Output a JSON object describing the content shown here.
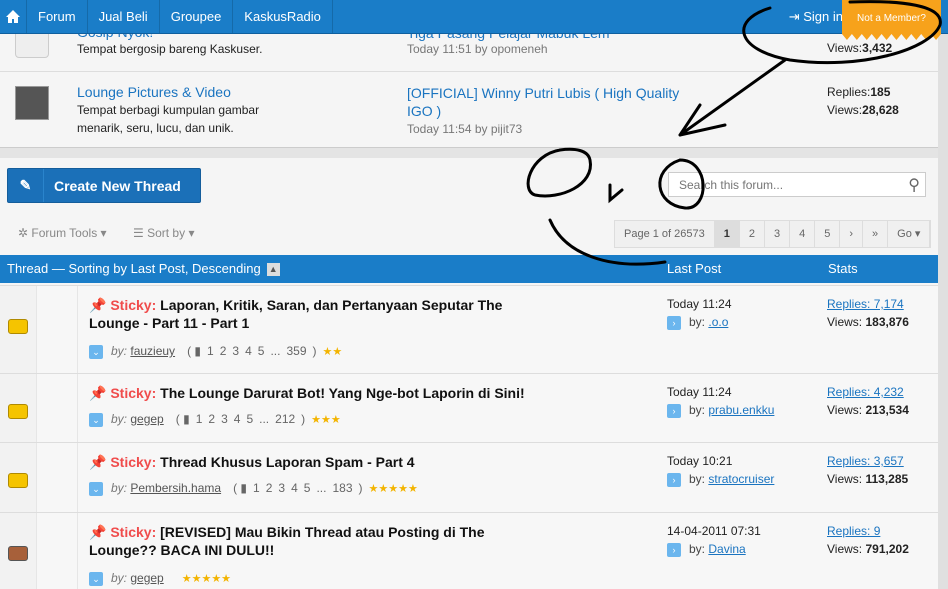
{
  "nav": {
    "home_icon": "home-icon",
    "items": [
      "Forum",
      "Jual Beli",
      "Groupee",
      "KaskusRadio"
    ],
    "sign_in": "Sign in",
    "not_member": "Not a Member?"
  },
  "subforums": [
    {
      "name": "Gosip Nyok!",
      "desc": "Tempat bergosip bareng Kaskuser.",
      "last_post": "Tiga Pasang Pelajar Mabuk Lem",
      "last_meta": "Today 11:51 by opomeneh",
      "replies_label": "Replies:",
      "replies": "",
      "views_label": "Views:",
      "views": "3,432"
    },
    {
      "name": "Lounge Pictures & Video",
      "desc": "Tempat berbagi kumpulan gambar menarik, seru, lucu, dan unik.",
      "last_post": "[OFFICIAL] Winny Putri Lubis ( High Quality IGO )",
      "last_meta": "Today 11:54 by pijit73",
      "replies_label": "Replies:",
      "replies": "185",
      "views_label": "Views:",
      "views": "28,628"
    }
  ],
  "toolbar": {
    "create_label": "Create New Thread",
    "search_placeholder": "Search this forum...",
    "forum_tools": "Forum Tools",
    "sort_by": "Sort by"
  },
  "pager": {
    "label": "Page 1 of 26573",
    "pages": [
      "1",
      "2",
      "3",
      "4",
      "5"
    ],
    "next": "›",
    "last": "»",
    "go": "Go"
  },
  "header": {
    "thread": "Thread",
    "sorting": "— Sorting by",
    "sort_field": "Last Post",
    "sort_dir": ", Descending",
    "last_post": "Last Post",
    "stats": "Stats"
  },
  "threads": [
    {
      "prefix": "Sticky:",
      "title": "Laporan, Kritik, Saran, dan Pertanyaan Seputar The Lounge - Part 11 - Part 1",
      "by": "by:",
      "author": "fauzieuy",
      "pages": [
        "1",
        "2",
        "3",
        "4",
        "5",
        "...",
        "359"
      ],
      "rating": 2,
      "locked": false,
      "last_time": "Today 11:24",
      "last_by": "by:",
      "last_user": ".o.o",
      "replies": "Replies: 7,174",
      "views_label": "Views:",
      "views": "183,876"
    },
    {
      "prefix": "Sticky:",
      "title": "The Lounge Darurat Bot! Yang Nge-bot Laporin di Sini!",
      "by": "by:",
      "author": "gegep",
      "pages": [
        "1",
        "2",
        "3",
        "4",
        "5",
        "...",
        "212"
      ],
      "rating": 3,
      "locked": false,
      "last_time": "Today 11:24",
      "last_by": "by:",
      "last_user": "prabu.enkku",
      "replies": "Replies: 4,232",
      "views_label": "Views:",
      "views": "213,534"
    },
    {
      "prefix": "Sticky:",
      "title": "Thread Khusus Laporan Spam - Part 4",
      "by": "by:",
      "author": "Pembersih.hama",
      "pages": [
        "1",
        "2",
        "3",
        "4",
        "5",
        "...",
        "183"
      ],
      "rating": 5,
      "locked": false,
      "last_time": "Today 10:21",
      "last_by": "by:",
      "last_user": "stratocruiser",
      "replies": "Replies: 3,657",
      "views_label": "Views:",
      "views": "113,285"
    },
    {
      "prefix": "Sticky:",
      "title": "[REVISED] Mau Bikin Thread atau Posting di The Lounge?? BACA INI DULU!!",
      "by": "by:",
      "author": "gegep",
      "pages": [],
      "rating": 5,
      "locked": true,
      "last_time": "14-04-2011 07:31",
      "last_by": "by:",
      "last_user": "Davina",
      "replies": "Replies: 9",
      "views_label": "Views:",
      "views": "791,202"
    }
  ],
  "colors": {
    "nav": "#1a7dc8",
    "accent_orange": "#f7a21b",
    "sticky": "#f04c4c",
    "link": "#1a74c0"
  }
}
